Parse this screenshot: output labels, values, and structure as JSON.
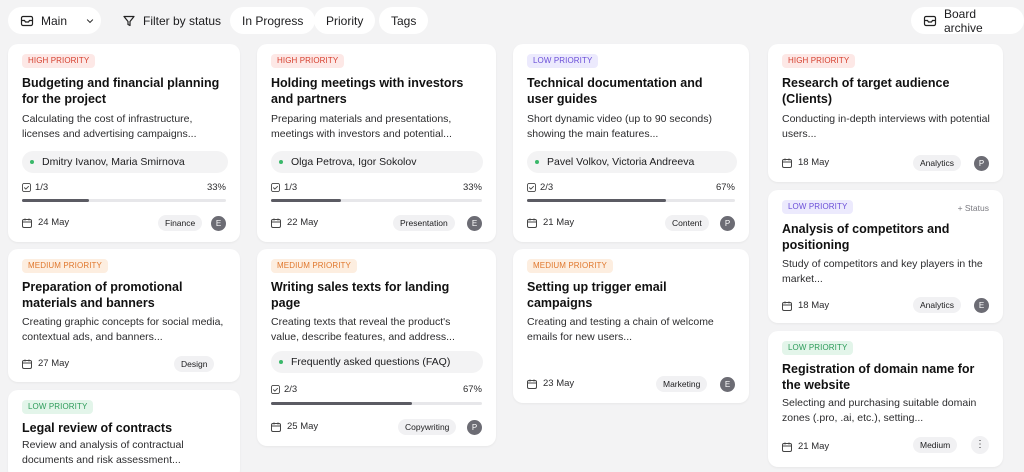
{
  "toolbar": {
    "main_label": "Main",
    "filter_label": "Filter by status",
    "tab_in_progress": "In Progress",
    "tab_priority": "Priority",
    "tab_tags": "Tags",
    "archive_label": "Board archive"
  },
  "cards": [
    {
      "priority": "HIGH PRIORITY",
      "title": "Budgeting and financial planning for the project",
      "desc": "Calculating the cost of infrastructure, licenses and advertising campaigns...",
      "assignees": "Dmitry Ivanov, Maria Smirnova",
      "progress": "1/3",
      "pct": "33%",
      "pct_value": 0.33,
      "date": "24 May",
      "tag": "Finance",
      "avatar": "E"
    },
    {
      "priority": "HIGH PRIORITY",
      "title": "Holding meetings with investors and partners",
      "desc": "Preparing materials and presentations, meetings with investors and potential...",
      "assignees": "Olga Petrova, Igor Sokolov",
      "progress": "1/3",
      "pct": "33%",
      "pct_value": 0.33,
      "date": "22 May",
      "tag": "Presentation",
      "avatar": "E"
    },
    {
      "priority": "LOW PRIORITY",
      "title": "Technical documentation and user guides",
      "desc": "Short dynamic video (up to 90 seconds) showing the main features...",
      "assignees": "Pavel Volkov, Victoria Andreeva",
      "progress": "2/3",
      "pct": "67%",
      "pct_value": 0.67,
      "date": "21 May",
      "tag": "Content",
      "avatar": "P"
    },
    {
      "priority": "HIGH PRIORITY",
      "title": "Research of target audience (Clients)",
      "desc": "Conducting in-depth interviews with potential users...",
      "date": "18 May",
      "tag": "Analytics",
      "avatar": "P"
    },
    {
      "priority": "MEDIUM PRIORITY",
      "title": "Preparation of promotional materials and banners",
      "desc": "Creating graphic concepts for social media, contextual ads, and banners...",
      "date": "27 May",
      "tag": "Design"
    },
    {
      "priority": "MEDIUM PRIORITY",
      "title": "Writing sales texts for landing page",
      "desc": "Creating texts that reveal the product's value, describe features, and address...",
      "subtask": "Frequently asked questions (FAQ)",
      "progress": "2/3",
      "pct": "67%",
      "pct_value": 0.67,
      "date": "25 May",
      "tag": "Copywriting",
      "avatar": "P"
    },
    {
      "priority": "MEDIUM PRIORITY",
      "title": "Setting up trigger email campaigns",
      "desc": "Creating and testing a chain of welcome emails for new users...",
      "date": "23 May",
      "tag": "Marketing",
      "avatar": "E"
    },
    {
      "priority": "LOW PRIORITY",
      "title": "Analysis of competitors and positioning",
      "desc": "Study of competitors and key players in the market...",
      "status_action": "+ Status",
      "date": "18 May",
      "tag": "Analytics",
      "avatar": "E"
    },
    {
      "priority": "LOW PRIORITY",
      "title": "Legal review of contracts",
      "desc": "Review and analysis of contractual documents and risk assessment..."
    },
    {
      "priority": "LOW PRIORITY",
      "title": "Registration of domain name for the website",
      "desc": "Selecting and purchasing suitable domain zones (.pro, .ai, etc.), setting...",
      "date": "21 May",
      "tag": "Medium",
      "menu": "⋮"
    }
  ],
  "icons": {
    "main": "board-icon",
    "filter": "filter-icon",
    "archive": "archive-icon",
    "date": "calendar-icon",
    "progress": "checklist-icon"
  },
  "colors": {
    "high": "#d6402f",
    "medium": "#e0782e",
    "low": "#6b4fd8",
    "low_green": "#2e9c5a",
    "dot": "#3ab86a"
  }
}
